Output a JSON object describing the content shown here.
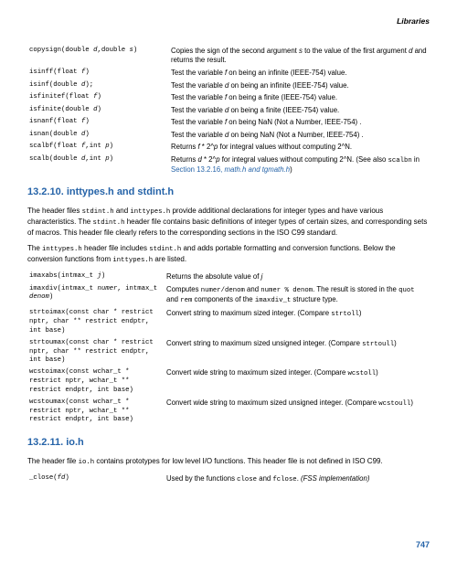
{
  "header": "Libraries",
  "table1": [
    {
      "sig": "copysign(double <i>d</i>,double <i>s</i>)",
      "desc": "Copies the sign of the second argument <i>s</i> to the value of the first argument <i>d</i> and returns the result."
    },
    {
      "sig": "isinff(float <i>f</i>)",
      "desc": "Test the variable <i>f</i> on being an infinite (IEEE-754) value."
    },
    {
      "sig": "isinf(double <i>d</i>);",
      "desc": "Test the variable <i>d</i> on being an infinite (IEEE-754) value."
    },
    {
      "sig": "isfinitef(float <i>f</i>)",
      "desc": "Test the variable <i>f</i> on being a finite (IEEE-754) value."
    },
    {
      "sig": "isfinite(double <i>d</i>)",
      "desc": "Test the variable <i>d</i> on being a finite (IEEE-754) value."
    },
    {
      "sig": "isnanf(float <i>f</i>)",
      "desc": "Test the variable <i>f</i> on being NaN (Not a Number, IEEE-754) ."
    },
    {
      "sig": "isnan(double <i>d</i>)",
      "desc": "Test the variable <i>d</i> on being NaN (Not a Number, IEEE-754) ."
    },
    {
      "sig": "scalbf(float <i>f</i>,int <i>p</i>)",
      "desc": "Returns <i>f</i> * 2^<i>p</i> for integral values without computing 2^N."
    },
    {
      "sig": "scalb(double <i>d</i>,int <i>p</i>)",
      "desc": "Returns <i>d</i> * 2^<i>p</i> for integral values without computing 2^N. (See also <span class=\"code\">scalbn</span> in <span class=\"link\">Section 13.2.16, <i>math.h and tgmath.h</i></span>)"
    }
  ],
  "section1": {
    "title": "13.2.10. inttypes.h and stdint.h",
    "p1": "The header files <span class=\"code\">stdint.h</span> and <span class=\"code\">inttypes.h</span> provide additional declarations for integer types and have various characteristics. The <span class=\"code\">stdint.h</span> header file contains basic definitions of integer types of certain sizes, and corresponding sets of macros. This header file clearly refers to the corresponding sections in the ISO C99 standard.",
    "p2": "The <span class=\"code\">inttypes.h</span> header file includes <span class=\"code\">stdint.h</span> and adds portable formatting and conversion functions. Below the conversion functions from <span class=\"code\">inttypes.h</span> are listed."
  },
  "table2": [
    {
      "sig": "imaxabs(intmax_t <i>j</i>)",
      "desc": "Returns the absolute value of <i>j</i>"
    },
    {
      "sig": "imaxdiv(intmax_t <i>numer</i>, intmax_t <i>denom</i>)",
      "desc": "Computes <span class=\"code\">numer/denom</span> and <span class=\"code\">numer % denom</span>. The result is stored in the <span class=\"code\">quot</span> and <span class=\"code\">rem</span> components of the <span class=\"code\">imaxdiv_t</span> structure type."
    },
    {
      "sig": "strtoimax(const char * restrict nptr, char ** restrict endptr, int base)",
      "desc": "Convert string to maximum sized integer. (Compare <span class=\"code\">strtoll</span>)"
    },
    {
      "sig": "strtoumax(const char * restrict nptr, char ** restrict endptr, int base)",
      "desc": "Convert string to maximum sized unsigned integer. (Compare <span class=\"code\">strtoull</span>)"
    },
    {
      "sig": "wcstoimax(const wchar_t * restrict nptr, wchar_t ** restrict endptr, int base)",
      "desc": "Convert wide string to maximum sized integer. (Compare <span class=\"code\">wcstoll</span>)"
    },
    {
      "sig": "wcstoumax(const wchar_t * restrict nptr, wchar_t ** restrict endptr, int base)",
      "desc": "Convert wide string to maximum sized unsigned integer. (Compare <span class=\"code\">wcstoull</span>)"
    }
  ],
  "section2": {
    "title": "13.2.11. io.h",
    "p1": "The header file <span class=\"code\">io.h</span> contains prototypes for low level I/O functions. This header file is not defined in ISO C99."
  },
  "table3": [
    {
      "sig": "_close(<i>fd</i>)",
      "desc": "Used by the functions <span class=\"code\">close</span> and <span class=\"code\">fclose</span>. <i>(FSS implementation)</i>"
    }
  ],
  "pageNum": "747"
}
